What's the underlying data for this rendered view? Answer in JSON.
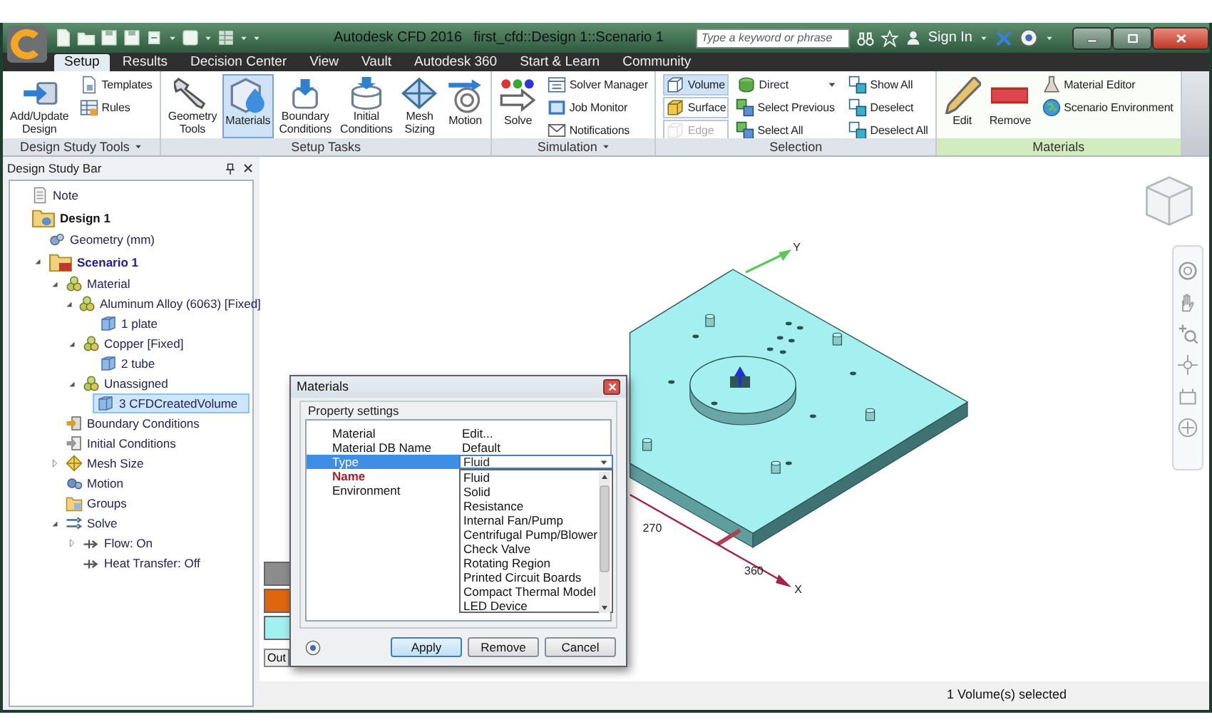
{
  "window": {
    "app_title": "Autodesk CFD 2016",
    "document_title": "first_cfd::Design 1::Scenario 1"
  },
  "search": {
    "placeholder": "Type a keyword or phrase"
  },
  "sign_in": "Sign In",
  "tabs": [
    {
      "label": "Setup",
      "selected": true
    },
    {
      "label": "Results",
      "selected": false
    },
    {
      "label": "Decision Center",
      "selected": false
    },
    {
      "label": "View",
      "selected": false
    },
    {
      "label": "Vault",
      "selected": false
    },
    {
      "label": "Autodesk 360",
      "selected": false
    },
    {
      "label": "Start & Learn",
      "selected": false
    },
    {
      "label": "Community",
      "selected": false
    }
  ],
  "ribbon_groups": [
    {
      "title": "Design Study Tools",
      "menu": true,
      "contextual": false,
      "items": [
        {
          "kind": "large",
          "label": "Add/Update Design",
          "selected": false,
          "disabled": false
        },
        {
          "kind": "small",
          "label": "Templates",
          "selected": false,
          "disabled": false
        },
        {
          "kind": "small",
          "label": "Rules",
          "selected": false,
          "disabled": false
        }
      ]
    },
    {
      "title": "Setup Tasks",
      "menu": false,
      "contextual": false,
      "items": [
        {
          "kind": "large",
          "label": "Geometry Tools",
          "selected": false,
          "disabled": false
        },
        {
          "kind": "large",
          "label": "Materials",
          "selected": true,
          "disabled": false
        },
        {
          "kind": "large",
          "label": "Boundary Conditions",
          "selected": false,
          "disabled": false
        },
        {
          "kind": "large",
          "label": "Initial Conditions",
          "selected": false,
          "disabled": false
        },
        {
          "kind": "large",
          "label": "Mesh Sizing",
          "selected": false,
          "disabled": false
        },
        {
          "kind": "large",
          "label": "Motion",
          "selected": false,
          "disabled": false
        }
      ]
    },
    {
      "title": "Simulation",
      "menu": true,
      "contextual": false,
      "items": [
        {
          "kind": "large",
          "label": "Solve",
          "selected": false,
          "disabled": false
        },
        {
          "kind": "small",
          "label": "Solver Manager",
          "selected": false,
          "disabled": false
        },
        {
          "kind": "small",
          "label": "Job Monitor",
          "selected": false,
          "disabled": false
        },
        {
          "kind": "small",
          "label": "Notifications",
          "selected": false,
          "disabled": false
        }
      ]
    },
    {
      "title": "Selection",
      "menu": false,
      "contextual": false,
      "items": [
        {
          "kind": "toggle",
          "label": "Volume",
          "selected": true,
          "disabled": false
        },
        {
          "kind": "toggle",
          "label": "Surface",
          "selected": false,
          "disabled": false
        },
        {
          "kind": "toggle",
          "label": "Edge",
          "selected": false,
          "disabled": true
        },
        {
          "kind": "dropdown",
          "label": "Direct",
          "selected": false,
          "disabled": false
        },
        {
          "kind": "small",
          "label": "Select Previous",
          "selected": false,
          "disabled": false
        },
        {
          "kind": "small",
          "label": "Select All",
          "selected": false,
          "disabled": false
        },
        {
          "kind": "small",
          "label": "Show All",
          "selected": false,
          "disabled": false
        },
        {
          "kind": "small",
          "label": "Deselect",
          "selected": false,
          "disabled": false
        },
        {
          "kind": "small",
          "label": "Deselect All",
          "selected": false,
          "disabled": false
        }
      ]
    },
    {
      "title": "Materials",
      "menu": false,
      "contextual": true,
      "items": [
        {
          "kind": "large",
          "label": "Edit",
          "selected": false,
          "disabled": false
        },
        {
          "kind": "large",
          "label": "Remove",
          "selected": false,
          "disabled": false
        },
        {
          "kind": "small",
          "label": "Material Editor",
          "selected": false,
          "disabled": false
        },
        {
          "kind": "small",
          "label": "Scenario Environment",
          "selected": false,
          "disabled": false
        }
      ]
    }
  ],
  "design_study_bar": {
    "title": "Design Study Bar",
    "tree": [
      {
        "label": "Note",
        "kind": "note",
        "selected": false
      },
      {
        "label": "Design 1",
        "kind": "design",
        "selected": false,
        "children": [
          {
            "label": "Geometry (mm)",
            "kind": "geometry",
            "selected": false
          },
          {
            "label": "Scenario 1",
            "kind": "scenario",
            "expanded": true,
            "selected": false,
            "children": [
              {
                "label": "Material",
                "kind": "material",
                "expanded": true,
                "selected": false,
                "children": [
                  {
                    "label": "Aluminum Alloy (6063) [Fixed]",
                    "kind": "material",
                    "expanded": true,
                    "selected": false,
                    "children": [
                      {
                        "label": "1 plate",
                        "kind": "part",
                        "selected": false
                      }
                    ]
                  },
                  {
                    "label": "Copper [Fixed]",
                    "kind": "material",
                    "expanded": true,
                    "selected": false,
                    "children": [
                      {
                        "label": "2 tube",
                        "kind": "part",
                        "selected": false
                      }
                    ]
                  },
                  {
                    "label": "Unassigned",
                    "kind": "material",
                    "expanded": true,
                    "selected": false,
                    "children": [
                      {
                        "label": "3 CFDCreatedVolume",
                        "kind": "part",
                        "selected": true
                      }
                    ]
                  }
                ]
              },
              {
                "label": "Boundary Conditions",
                "kind": "boundary",
                "selected": false
              },
              {
                "label": "Initial Conditions",
                "kind": "initial",
                "selected": false
              },
              {
                "label": "Mesh Size",
                "kind": "mesh",
                "expanded": false,
                "selected": false
              },
              {
                "label": "Motion",
                "kind": "motion",
                "selected": false
              },
              {
                "label": "Groups",
                "kind": "groups",
                "selected": false
              },
              {
                "label": "Solve",
                "kind": "solve",
                "expanded": true,
                "selected": false,
                "children": [
                  {
                    "label": "Flow: On",
                    "kind": "flow",
                    "expanded": false,
                    "selected": false
                  },
                  {
                    "label": "Heat Transfer: Off",
                    "kind": "flow",
                    "selected": false
                  }
                ]
              }
            ]
          }
        ]
      }
    ]
  },
  "viewport": {
    "axis_labels": [
      {
        "kind": "y",
        "label": "Y"
      },
      {
        "kind": "x",
        "label": "X"
      }
    ],
    "dimension_labels": [
      "270",
      "360"
    ],
    "legend_swatches": [
      {
        "color": "#8c8c8c"
      },
      {
        "color": "#e0650f"
      },
      {
        "color": "#a2f0f0"
      }
    ],
    "output_tab": "Out"
  },
  "materials_dialog": {
    "title": "Materials",
    "section": "Property settings",
    "properties": [
      {
        "label": "Material",
        "value": "Edit...",
        "kind": "text",
        "selected": false,
        "required": false
      },
      {
        "label": "Material DB Name",
        "value": "Default",
        "kind": "text",
        "selected": false,
        "required": false
      },
      {
        "label": "Type",
        "value": "Fluid",
        "kind": "combo",
        "selected": true,
        "required": false
      },
      {
        "label": "Name",
        "kind": "text",
        "selected": false,
        "required": true
      },
      {
        "label": "Environment",
        "kind": "text",
        "selected": false,
        "required": false
      }
    ],
    "type_options": [
      {
        "label": "Fluid",
        "selected": false
      },
      {
        "label": "Solid",
        "selected": false
      },
      {
        "label": "Resistance",
        "selected": false
      },
      {
        "label": "Internal Fan/Pump",
        "selected": false
      },
      {
        "label": "Centrifugal Pump/Blower",
        "selected": false
      },
      {
        "label": "Check Valve",
        "selected": false
      },
      {
        "label": "Rotating Region",
        "selected": false
      },
      {
        "label": "Printed Circuit Boards",
        "selected": false
      },
      {
        "label": "Compact Thermal Model",
        "selected": false
      },
      {
        "label": "LED Device",
        "selected": false
      }
    ],
    "buttons": [
      {
        "label": "Apply",
        "default": true
      },
      {
        "label": "Remove",
        "default": false
      },
      {
        "label": "Cancel",
        "default": false
      }
    ]
  },
  "status_bar": {
    "text": "1 Volume(s) selected"
  }
}
